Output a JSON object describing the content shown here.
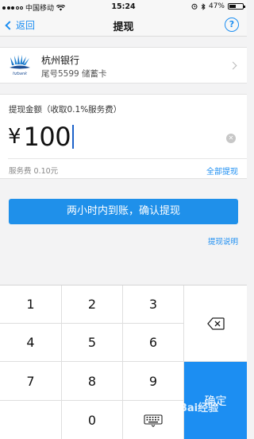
{
  "status_bar": {
    "carrier": "中国移动",
    "time": "15:24",
    "battery_percent_text": "47%",
    "battery_level": 0.47
  },
  "nav": {
    "back_label": "返回",
    "title": "提现",
    "help_label": "?"
  },
  "bank": {
    "logo_text": "hzbank",
    "name": "杭州银行",
    "card_info": "尾号5599 储蓄卡"
  },
  "amount": {
    "label": "提现金额（收取0.1%服务费）",
    "currency": "¥",
    "value": "100",
    "fee_text": "服务费 0.10元",
    "all_withdraw_label": "全部提现"
  },
  "actions": {
    "confirm_label": "两小时内到账，确认提现",
    "explain_label": "提现说明"
  },
  "keypad": {
    "keys": [
      "1",
      "2",
      "3",
      "4",
      "5",
      "6",
      "7",
      "8",
      "9",
      "0"
    ],
    "ok_label": "确定"
  },
  "watermark": {
    "text": "Bai经验"
  },
  "colors": {
    "accent": "#1c8ef2",
    "confirm_button": "#1f90ea",
    "background": "#f3f3f4"
  }
}
